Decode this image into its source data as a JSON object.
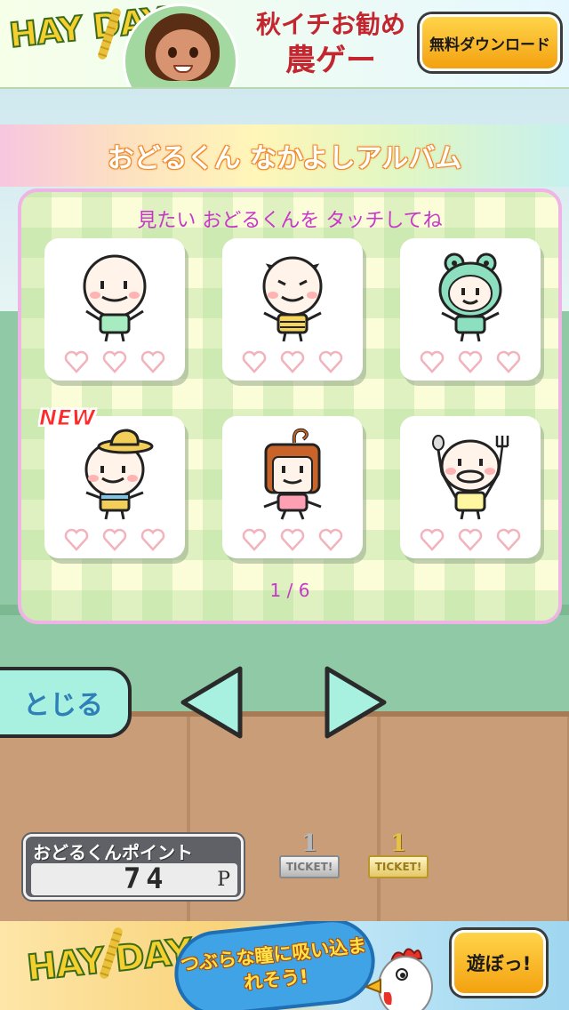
{
  "ad_top": {
    "logo": "HAY DAY",
    "line1": "秋イチお勧め",
    "line2": "農ゲー",
    "button_label": "無料ダウンロード"
  },
  "album": {
    "title": "おどるくん なかよしアルバム",
    "hint": "見たい おどるくんを タッチしてね",
    "page": "1 / 6",
    "new_label": "NEW",
    "cards": [
      {
        "character": "plain-odorukun",
        "hearts": 3,
        "is_new": false
      },
      {
        "character": "horned-odorukun",
        "hearts": 3,
        "is_new": false
      },
      {
        "character": "frog-hood-odorukun",
        "hearts": 3,
        "is_new": false
      },
      {
        "character": "straw-hat-odorukun",
        "hearts": 3,
        "is_new": true
      },
      {
        "character": "ponytail-odorukun",
        "hearts": 3,
        "is_new": false
      },
      {
        "character": "spoon-fork-odorukun",
        "hearts": 3,
        "is_new": false
      }
    ]
  },
  "nav": {
    "close_label": "とじる",
    "prev_icon": "left-arrow-icon",
    "next_icon": "right-arrow-icon"
  },
  "points": {
    "label": "おどるくんポイント",
    "value": "74",
    "unit": "P"
  },
  "tickets": [
    {
      "count": "1",
      "label": "TICKET!",
      "kind": "silver"
    },
    {
      "count": "1",
      "label": "TICKET!",
      "kind": "gold"
    }
  ],
  "ad_bottom": {
    "logo": "HAY DAY",
    "bubble_text": "つぶらな瞳に吸い込まれそう!",
    "button_label": "遊ぼっ!"
  },
  "colors": {
    "accent_pink": "#c738c9",
    "heart": "#f2b3bd",
    "close_button": "#a8f0e0",
    "arrow": "#a8f0e0"
  }
}
